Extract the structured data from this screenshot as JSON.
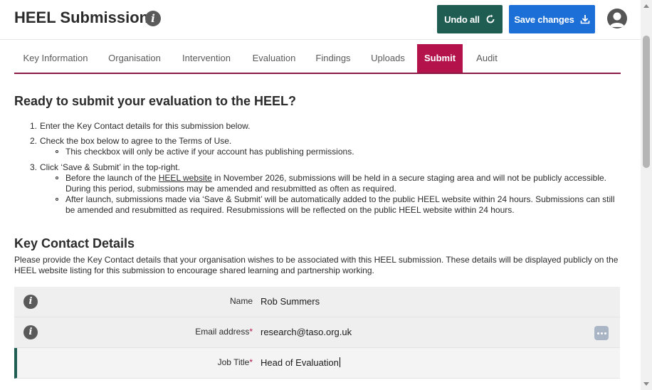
{
  "header": {
    "title": "HEEL Submissions",
    "undo_label": "Undo all",
    "save_label": "Save changes"
  },
  "tabs": [
    {
      "label": "Key Information",
      "active": false
    },
    {
      "label": "Organisation",
      "active": false
    },
    {
      "label": "Intervention",
      "active": false
    },
    {
      "label": "Evaluation",
      "active": false
    },
    {
      "label": "Findings",
      "active": false
    },
    {
      "label": "Uploads",
      "active": false
    },
    {
      "label": "Submit",
      "active": true
    },
    {
      "label": "Audit",
      "active": false
    }
  ],
  "submit": {
    "heading": "Ready to submit your evaluation to the HEEL?",
    "step1": "Enter the Key Contact details for this submission below.",
    "step2": "Check the box below to agree to the Terms of Use.",
    "step2_sub": "This checkbox will only be active if your account has publishing permissions.",
    "step3": "Click ‘Save & Submit’ in the top-right.",
    "step3_sub1_pre": "Before the launch of the ",
    "step3_sub1_link": "HEEL website",
    "step3_sub1_post": " in November 2026, submissions will be held in a secure staging area and will not be publicly accessible. During this period, submissions may be amended and resubmitted as often as required.",
    "step3_sub2": "After launch, submissions made via ‘Save & Submit’ will be automatically added to the public HEEL website within 24 hours. Submissions can still be amended and resubmitted as required. Resubmissions will be reflected on the public HEEL website within 24 hours."
  },
  "key_contact": {
    "heading": "Key Contact Details",
    "description": "Please provide the Key Contact details that your organisation wishes to be associated with this HEEL submission. These details will be displayed publicly on the HEEL website listing for this submission to encourage shared learning and partnership working.",
    "fields": [
      {
        "label": "Name",
        "required": "",
        "value": "Rob Summers"
      },
      {
        "label": "Email address",
        "required": "*",
        "value": "research@taso.org.uk"
      },
      {
        "label": "Job Title",
        "required": "*",
        "value": "Head of Evaluation"
      }
    ]
  },
  "colors": {
    "accent_tab": "#b3124a",
    "undo_button": "#1f5c52",
    "save_button": "#1b6fd6"
  }
}
